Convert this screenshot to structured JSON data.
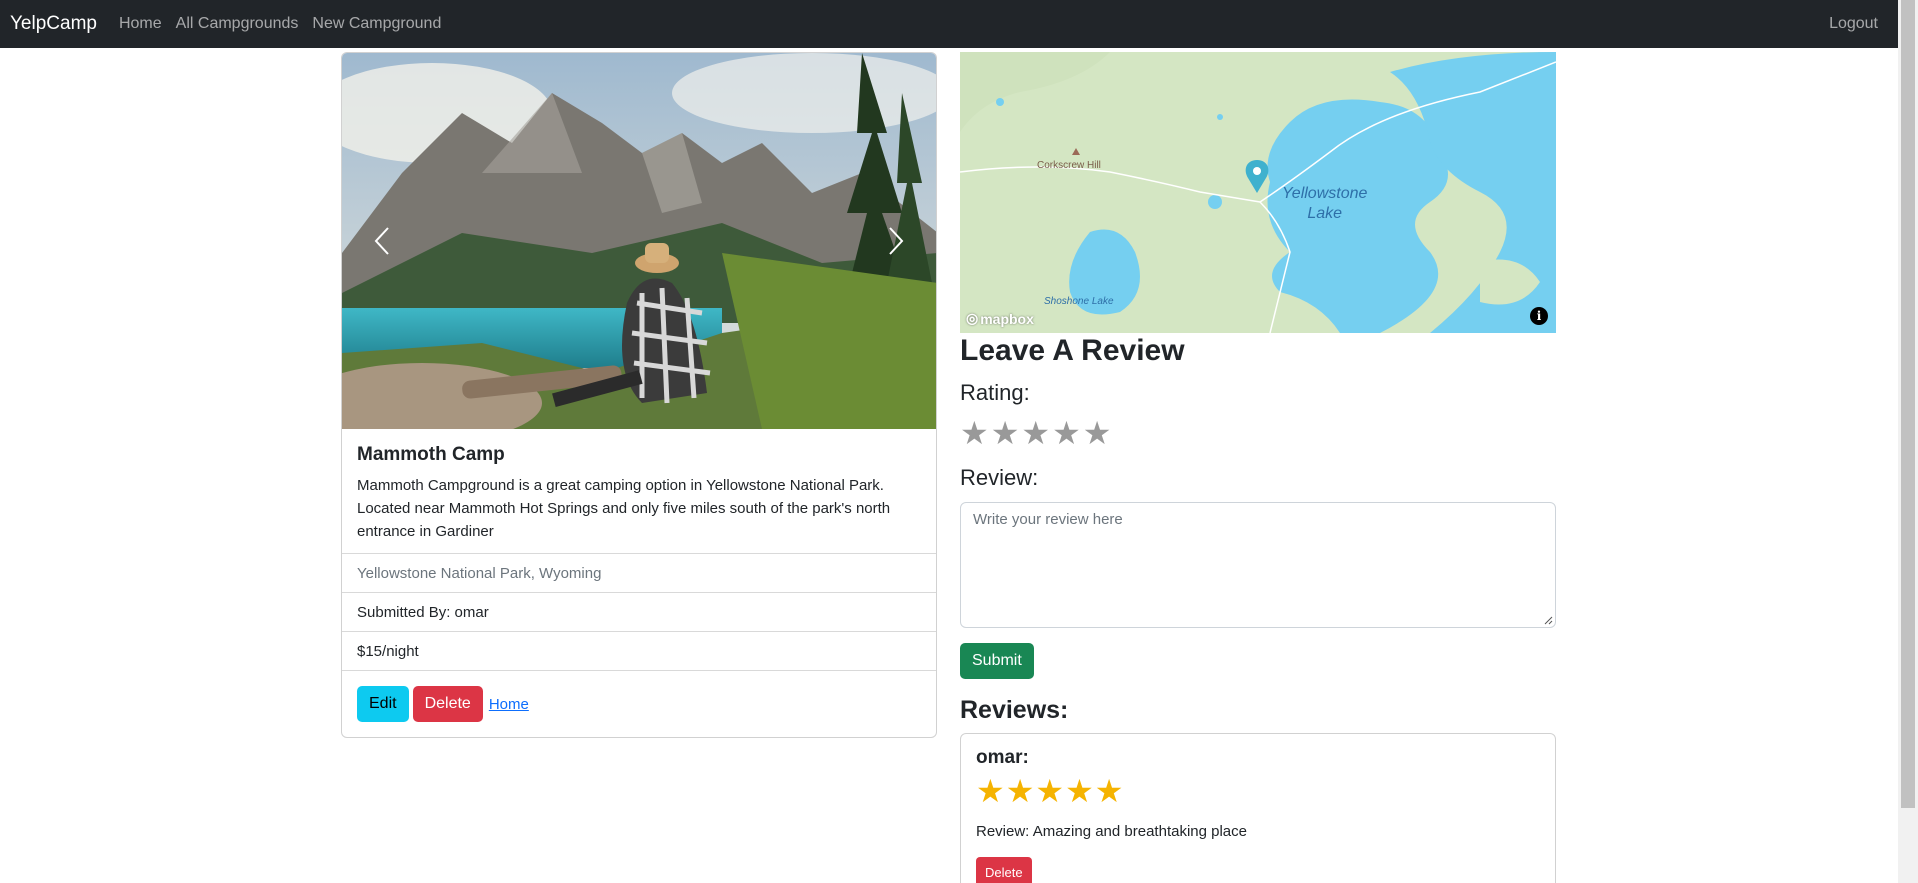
{
  "navbar": {
    "brand": "YelpCamp",
    "links": [
      "Home",
      "All Campgrounds",
      "New Campground"
    ],
    "logout": "Logout"
  },
  "campground": {
    "title": "Mammoth Camp",
    "description": "Mammoth Campground is a great camping option in Yellowstone National Park. Located near Mammoth Hot Springs and only five miles south of the park's north entrance in Gardiner",
    "location": "Yellowstone National Park, Wyoming",
    "submitted_by": "Submitted By: omar",
    "price": "$15/night",
    "edit_label": "Edit",
    "delete_label": "Delete",
    "home_link": "Home"
  },
  "map": {
    "labels": {
      "hill": "Corkscrew Hill",
      "lake_line1": "Yellowstone",
      "lake_line2": "Lake",
      "small_lake": "Shoshone Lake",
      "logo": "mapbox"
    }
  },
  "review_form": {
    "heading": "Leave A Review",
    "rating_label": "Rating:",
    "rating_value": 0,
    "rating_max": 5,
    "review_label": "Review:",
    "placeholder": "Write your review here",
    "submit_label": "Submit"
  },
  "reviews": {
    "heading": "Reviews:",
    "items": [
      {
        "author": "omar:",
        "rating": 5,
        "text": "Review: Amazing and breathtaking place",
        "delete_label": "Delete"
      }
    ]
  },
  "colors": {
    "navbar": "#212529",
    "info": "#0dcaf0",
    "danger": "#dc3545",
    "success": "#198754",
    "star_gold": "#f5b301",
    "star_gray": "#999999"
  }
}
